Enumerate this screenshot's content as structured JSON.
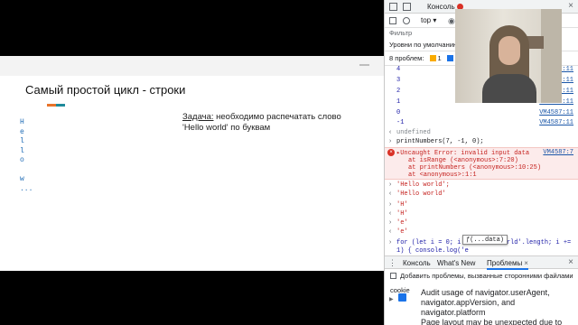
{
  "slide": {
    "title": "Самый простой цикл - строки",
    "vertical_letters": [
      "H",
      "e",
      "l",
      "l",
      "o",
      "",
      "w",
      "..."
    ],
    "task_label": "Задача:",
    "task_text": " необходимо распечатать слово 'Hello world' по буквам"
  },
  "devtools": {
    "tab_console": "Консоль",
    "context": "top ▾",
    "filter_placeholder": "Фильтр",
    "levels_label": "Уровни по умолчанию",
    "problems_label": "8 проблем:",
    "problems_warn": "1",
    "problems_info": "7",
    "console_lines": [
      {
        "value": "4",
        "src": "VM4587:11"
      },
      {
        "value": "3",
        "src": "VM4587:11"
      },
      {
        "value": "2",
        "src": "VM4587:11"
      },
      {
        "value": "1",
        "src": "VM4587:11"
      },
      {
        "value": "0",
        "src": "VM4587:11"
      },
      {
        "value": "-1",
        "src": "VM4587:11"
      }
    ],
    "undefined_text": "undefined",
    "call_text": "printNumbers(7, -1, 0);",
    "error": {
      "line1": "▸Uncaught Error: invalid input data",
      "src": "VM4587:7",
      "line2": "at isRange (<anonymous>:7:20)",
      "line3": "at printNumbers (<anonymous>:10:25)",
      "line4": "at <anonymous>:1:1"
    },
    "cmd1": "'Hello world';",
    "out1": "'Hello world'",
    "cmd2": "'H'",
    "out2": "'H'",
    "cmd3": "'e'",
    "out3": "'e'",
    "input_line1": "for (let i = 0; i < 'Hello world'.length; i +=",
    "input_line2": "1) { console.log('e",
    "tooltip": "ƒ(...data)",
    "drawer_tab_console": "Консоль",
    "drawer_tab_whatsnew": "What's New",
    "drawer_tab_problems": "Проблемы",
    "include_label": "Добавить проблемы, вызванные сторонними файлами cookie",
    "issue1": "Audit usage of navigator.userAgent, navigator.appVersion, and navigator.platform",
    "issue2": "Page layout may be unexpected due to"
  }
}
